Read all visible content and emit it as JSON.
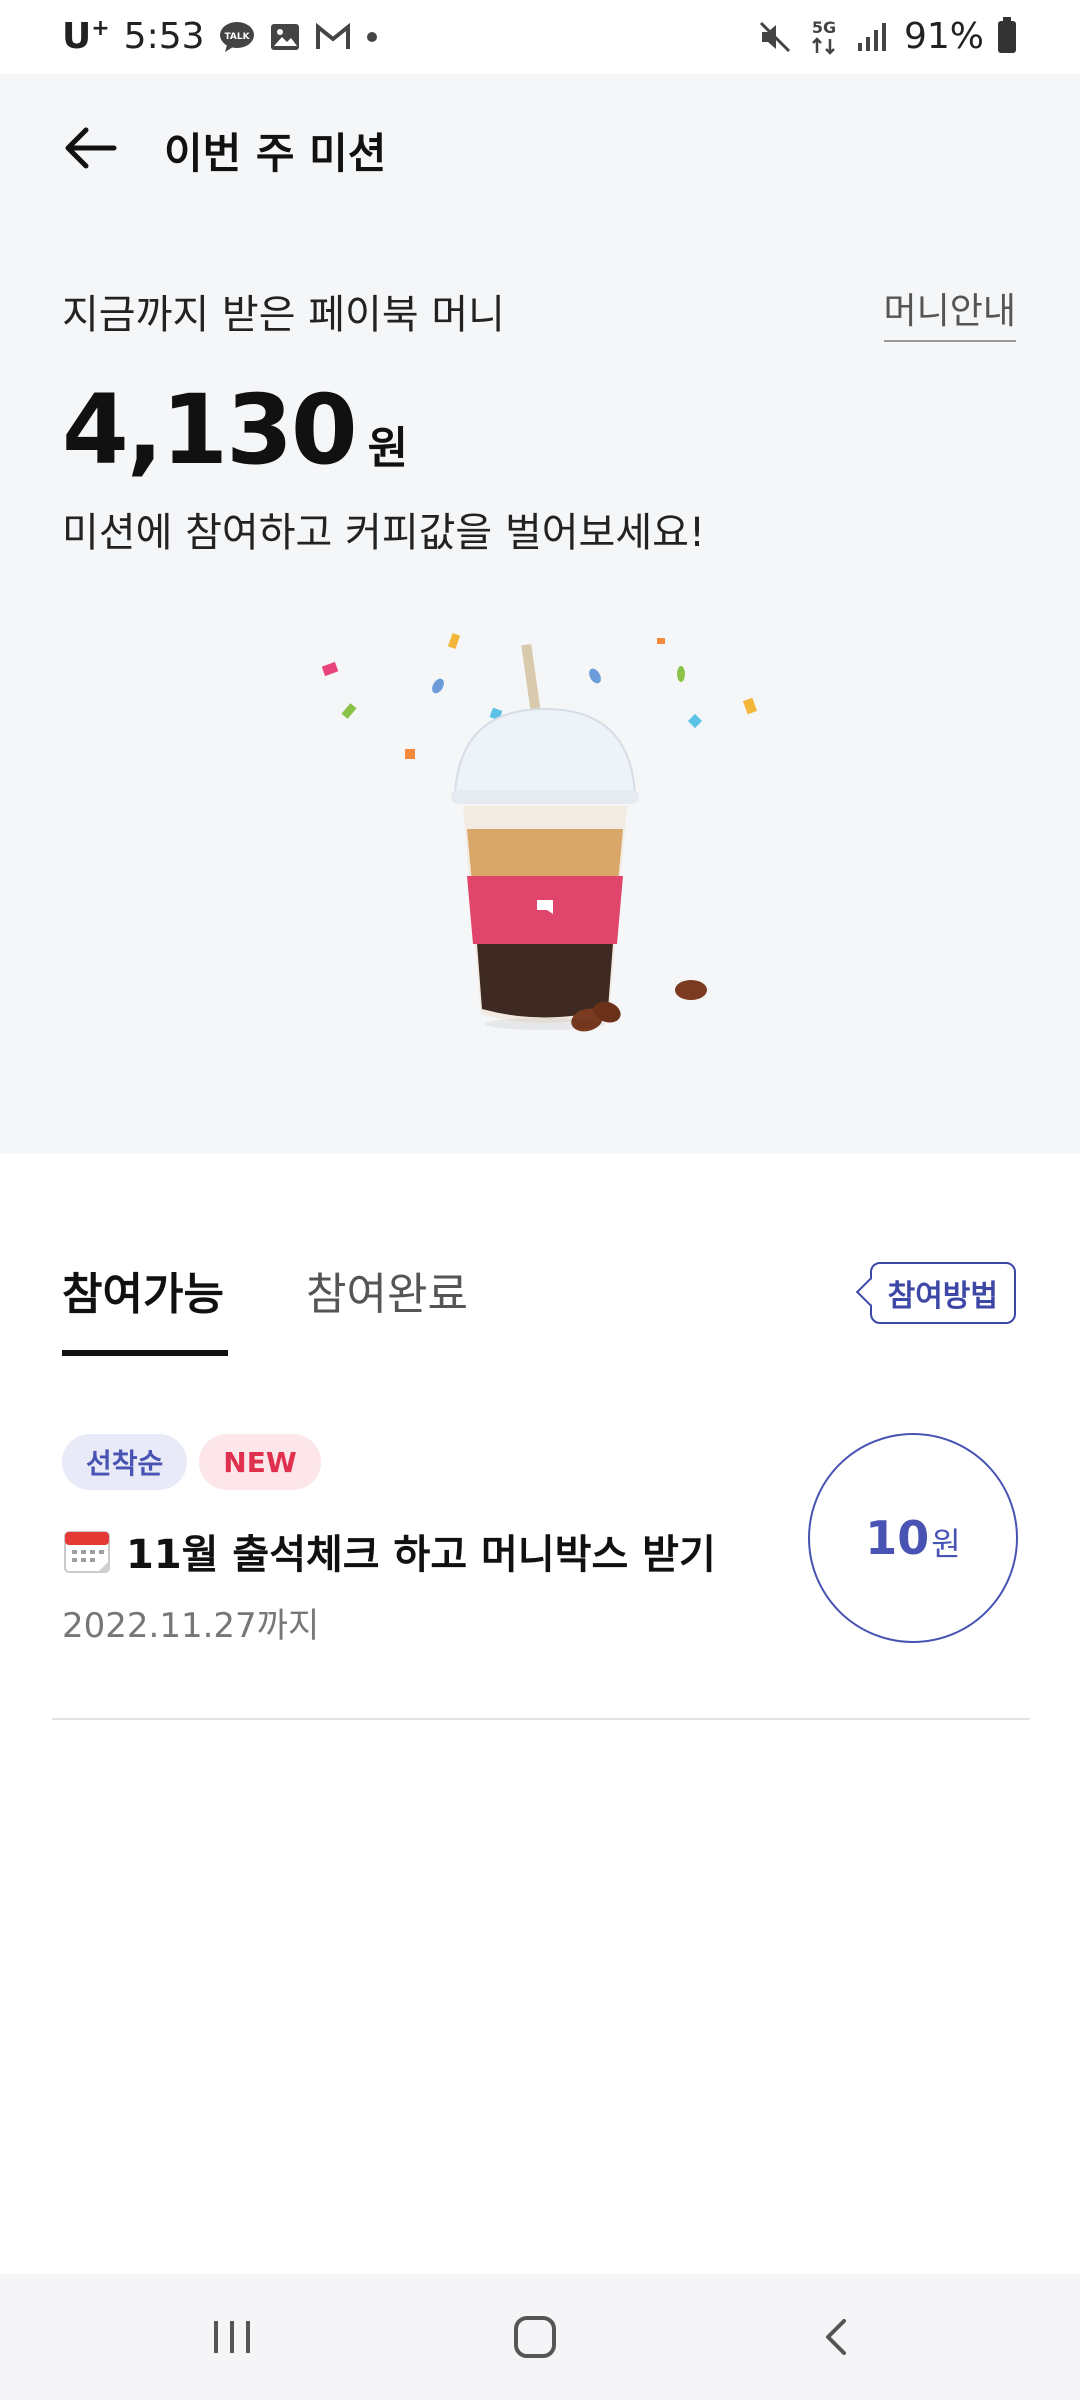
{
  "status_bar": {
    "carrier": "U",
    "carrier_sup": "+",
    "time": "5:53",
    "battery": "91%",
    "network": "5G",
    "icons": [
      "talk-icon",
      "gallery-icon",
      "gmail-icon",
      "dot-icon",
      "mute-icon",
      "5g-icon",
      "signal-icon",
      "battery-icon"
    ]
  },
  "header": {
    "title": "이번 주 미션"
  },
  "summary": {
    "label": "지금까지 받은 페이북 머니",
    "guide_link": "머니안내",
    "amount": "4,130",
    "unit": "원",
    "description": "미션에 참여하고 커피값을 벌어보세요!"
  },
  "tabs": {
    "available": "참여가능",
    "completed": "참여완료",
    "how_to": "참여방법"
  },
  "missions": [
    {
      "badge_first": "선착순",
      "badge_new": "NEW",
      "title": "11월 출석체크 하고 머니박스 받기",
      "due": "2022.11.27까지",
      "reward": "10",
      "reward_unit": "원"
    }
  ],
  "colors": {
    "accent": "#4853b3",
    "new_badge": "#e0304e",
    "top_bg": "#f5f6f8",
    "cup_sleeve": "#e0456b"
  }
}
